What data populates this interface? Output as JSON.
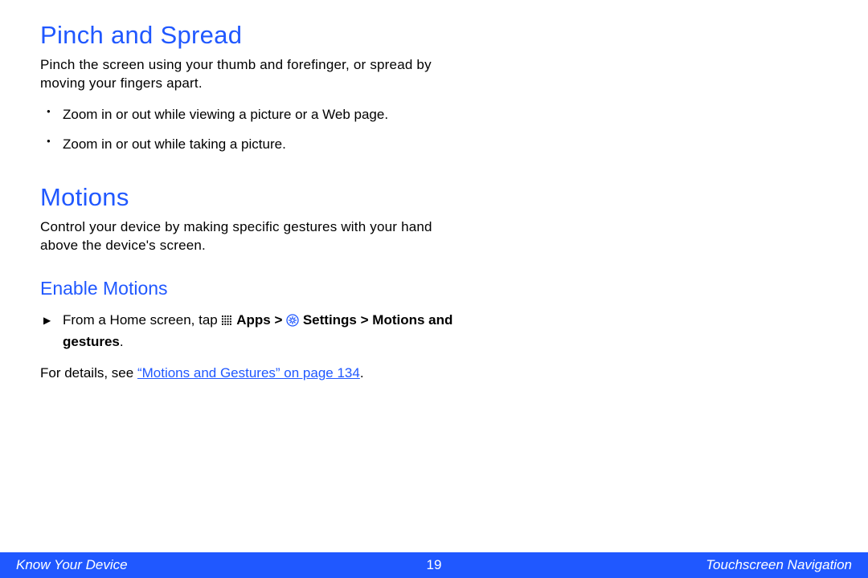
{
  "section1": {
    "title": "Pinch and Spread",
    "para": "Pinch the screen using your thumb and forefinger, or spread by moving your fingers apart.",
    "bullets": [
      "Zoom in or out while viewing a picture or a Web page.",
      "Zoom in or out while taking a picture."
    ]
  },
  "section2": {
    "title": "Motions",
    "para": "Control your device by making specific gestures with your hand above the device's screen."
  },
  "subsection": {
    "title": "Enable Motions",
    "instr": {
      "pre": "From a Home screen, tap ",
      "apps": "Apps",
      "gt1": " > ",
      "settings": "Settings",
      "gt2": " > ",
      "motions": "Motions and gestures",
      "period": "."
    },
    "ref_pre": "For details, see ",
    "ref_link": "“Motions and Gestures” on page 134",
    "ref_post": "."
  },
  "footer": {
    "left": "Know Your Device",
    "page": "19",
    "right": "Touchscreen Navigation"
  }
}
